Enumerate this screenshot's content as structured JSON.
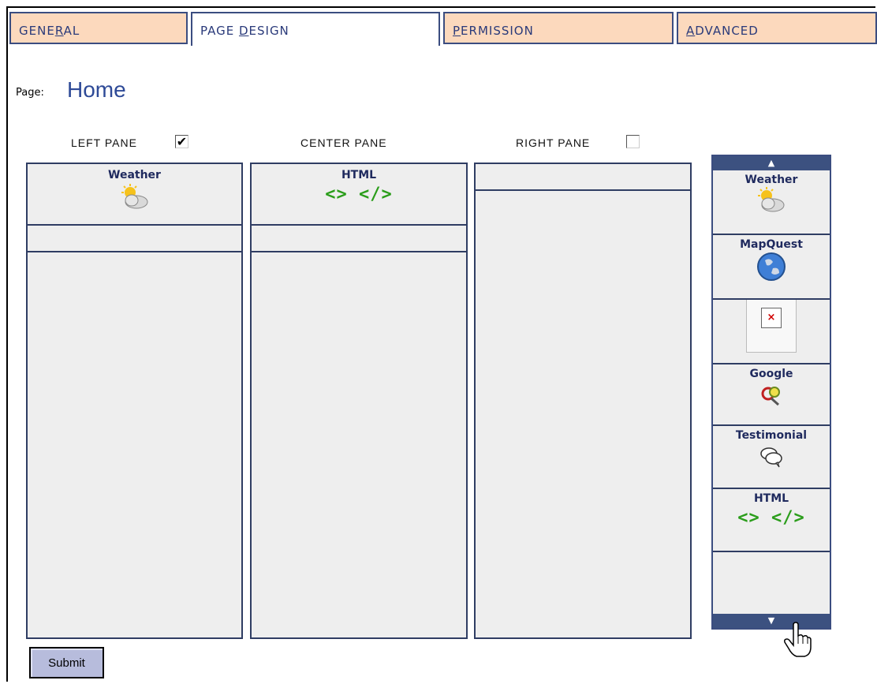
{
  "tabs": [
    {
      "pre": "GENE",
      "key": "R",
      "post": "AL"
    },
    {
      "pre": "PAGE ",
      "key": "D",
      "post": "ESIGN"
    },
    {
      "pre": "",
      "key": "P",
      "post": "ERMISSION"
    },
    {
      "pre": "",
      "key": "A",
      "post": "DVANCED"
    }
  ],
  "page": {
    "label": "Page:",
    "name": "Home"
  },
  "panes": {
    "left_label": "LEFT PANE",
    "left_checked": true,
    "center_label": "CENTER PANE",
    "right_label": "RIGHT PANE",
    "right_checked": false,
    "check_mark": "✔"
  },
  "left_pane": {
    "widget_title": "Weather",
    "icon": "weather-icon"
  },
  "center_pane": {
    "widget_title": "HTML",
    "code": "<> </>"
  },
  "palette": {
    "up_arrow": "▲",
    "down_arrow": "▼",
    "items": [
      {
        "title": "Weather",
        "icon": "weather-icon"
      },
      {
        "title": "MapQuest",
        "icon": "globe-icon"
      },
      {
        "title": "",
        "icon": "broken-image-icon",
        "mark": "×"
      },
      {
        "title": "Google",
        "icon": "magnifier-icon"
      },
      {
        "title": "Testimonial",
        "icon": "speech-bubbles-icon"
      },
      {
        "title": "HTML",
        "code": "<> </>"
      }
    ]
  },
  "submit_label": "Submit",
  "colors": {
    "tab_bg": "#fcd9bd",
    "border": "#2f3d63",
    "accent": "#2e4a97",
    "html_green": "#2a9d1a"
  }
}
